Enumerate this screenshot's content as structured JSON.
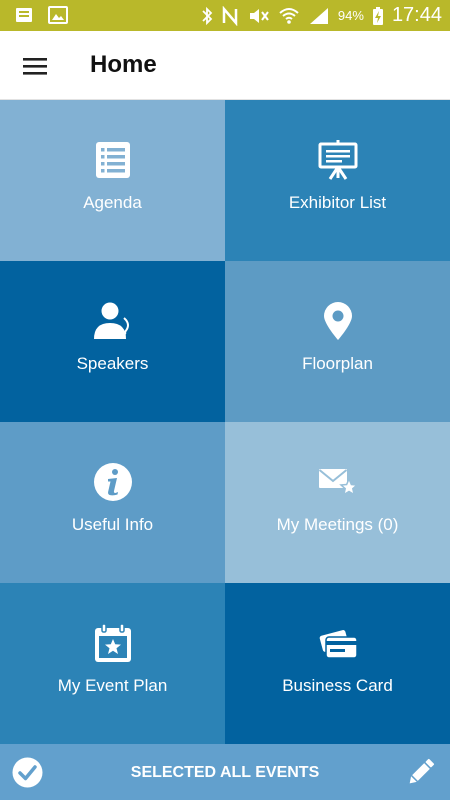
{
  "status_bar": {
    "battery_percent": "94%",
    "time": "17:44",
    "background": "#b9b82a"
  },
  "app_bar": {
    "title": "Home"
  },
  "tiles": [
    {
      "label": "Agenda",
      "icon": "list-icon",
      "color": "#82b1d3"
    },
    {
      "label": "Exhibitor List",
      "icon": "presentation-board-icon",
      "color": "#2c83b6"
    },
    {
      "label": "Speakers",
      "icon": "speaker-person-icon",
      "color": "#02629f"
    },
    {
      "label": "Floorplan",
      "icon": "map-pin-icon",
      "color": "#5d9bc4"
    },
    {
      "label": "Useful Info",
      "icon": "info-icon",
      "color": "#5e9cc7"
    },
    {
      "label": "My Meetings (0)",
      "icon": "mail-star-icon",
      "color": "#97bfd9"
    },
    {
      "label": "My Event Plan",
      "icon": "calendar-star-icon",
      "color": "#2c83b6"
    },
    {
      "label": "Business Card",
      "icon": "business-card-icon",
      "color": "#02629f"
    }
  ],
  "bottom_bar": {
    "label": "SELECTED ALL EVENTS",
    "color": "#62a0cd"
  }
}
